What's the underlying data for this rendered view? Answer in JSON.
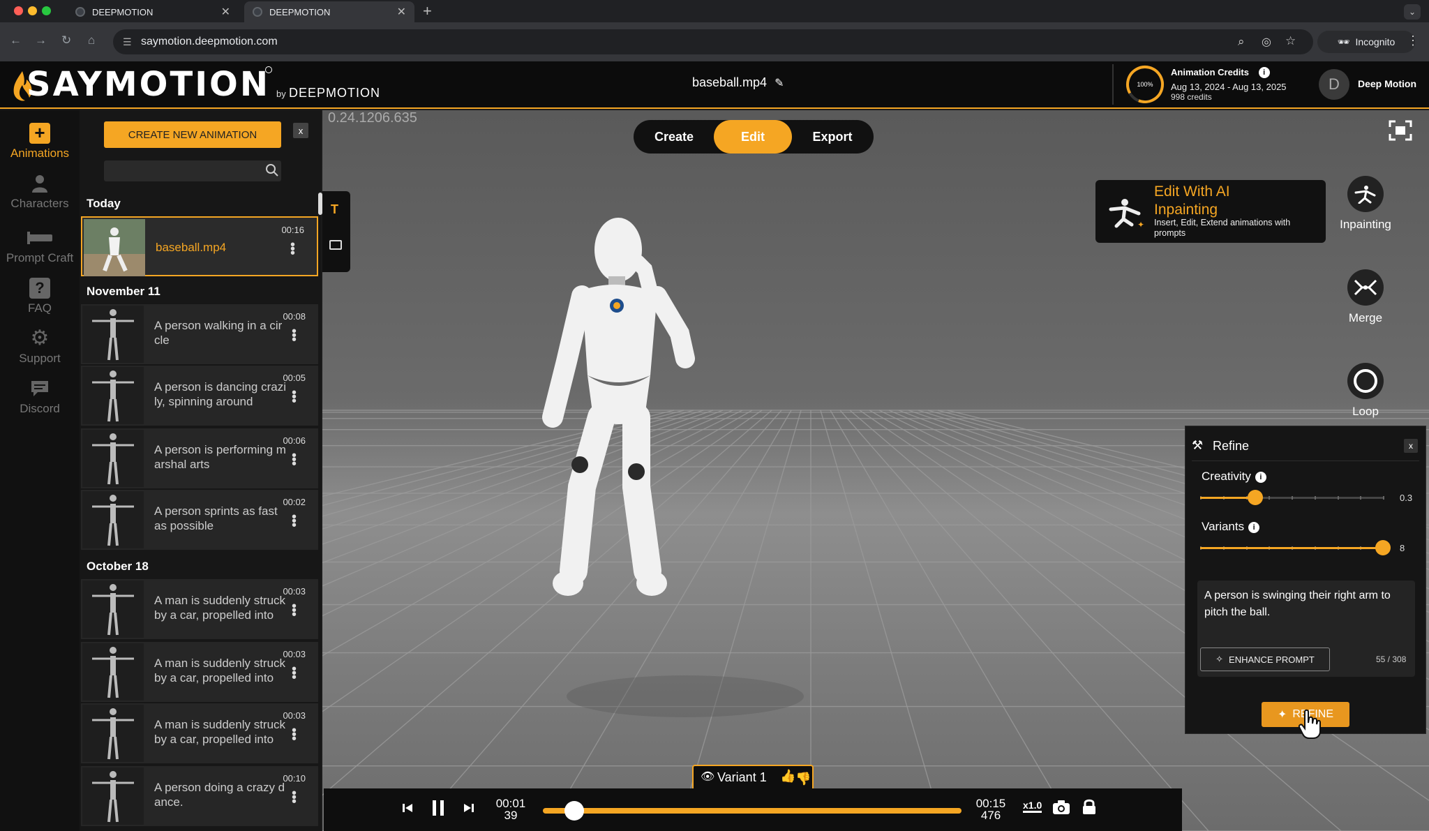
{
  "browser": {
    "tabs": [
      {
        "title": "DEEPMOTION",
        "active": false
      },
      {
        "title": "DEEPMOTION",
        "active": true
      }
    ],
    "new_tab": "+",
    "url": "saymotion.deepmotion.com",
    "incognito_label": "Incognito"
  },
  "header": {
    "logo_text": "SAYMOTION",
    "logo_by": "by",
    "logo_company": "DEEPMOTION",
    "filename": "baseball.mp4",
    "credits": {
      "percent": "100%",
      "title": "Animation Credits",
      "dates": "Aug 13, 2024 - Aug 13, 2025",
      "count": "998 credits"
    },
    "user_initial": "D",
    "user_name": "Deep Motion"
  },
  "leftnav": [
    {
      "label": "Animations",
      "icon": "plus-icon",
      "active": true
    },
    {
      "label": "Characters",
      "icon": "person-icon",
      "active": false
    },
    {
      "label": "Prompt Craft",
      "icon": "craft-icon",
      "active": false
    },
    {
      "label": "FAQ",
      "icon": "question-icon",
      "active": false
    },
    {
      "label": "Support",
      "icon": "gear-icon",
      "active": false
    },
    {
      "label": "Discord",
      "icon": "chat-icon",
      "active": false
    }
  ],
  "list": {
    "create_button": "CREATE NEW ANIMATION",
    "close": "x",
    "search_placeholder": "",
    "groups": [
      {
        "title": "Today",
        "items": [
          {
            "label": "baseball.mp4",
            "duration": "00:16",
            "selected": true
          }
        ]
      },
      {
        "title": "November 11",
        "items": [
          {
            "label": "A person walking in a circle",
            "duration": "00:08"
          },
          {
            "label": "A person is dancing crazily, spinning around",
            "duration": "00:05"
          },
          {
            "label": "A person is performing marshal arts",
            "duration": "00:06"
          },
          {
            "label": "A person sprints as fast as possible",
            "duration": "00:02"
          }
        ]
      },
      {
        "title": "October 18",
        "items": [
          {
            "label": "A man is suddenly struck by a car, propelled into",
            "duration": "00:03"
          },
          {
            "label": "A man is suddenly struck by a car, propelled into",
            "duration": "00:03"
          },
          {
            "label": "A man is suddenly struck by a car, propelled into",
            "duration": "00:03"
          },
          {
            "label": "A person doing a crazy dance.",
            "duration": "00:10"
          }
        ]
      }
    ]
  },
  "viewport": {
    "version": "0.24.1206.635",
    "modes": [
      "Create",
      "Edit",
      "Export"
    ],
    "active_mode": "Edit"
  },
  "ai_card": {
    "title": "Edit With AI Inpainting",
    "description": "Insert, Edit, Extend animations with prompts"
  },
  "side_tools": [
    "Inpainting",
    "Merge",
    "Loop"
  ],
  "refine": {
    "title": "Refine",
    "close": "x",
    "creativity_label": "Creativity",
    "creativity_value": "0.3",
    "creativity_fraction": 0.3,
    "variants_label": "Variants",
    "variants_value": "8",
    "variants_fraction": 1.0,
    "prompt": "A person is swinging their right arm to pitch the ball.",
    "enhance_label": "ENHANCE PROMPT",
    "char_count": "55 / 308",
    "refine_button": "REFINE"
  },
  "player": {
    "variant_label": "Variant 1",
    "current_time": "00:01",
    "current_frame": "39",
    "total_time": "00:15",
    "total_frame": "476",
    "speed": "x1.0",
    "progress_fraction": 0.07
  },
  "colors": {
    "accent": "#f5a623",
    "header_bg": "#0c0c0c",
    "panel_bg": "#171717"
  }
}
